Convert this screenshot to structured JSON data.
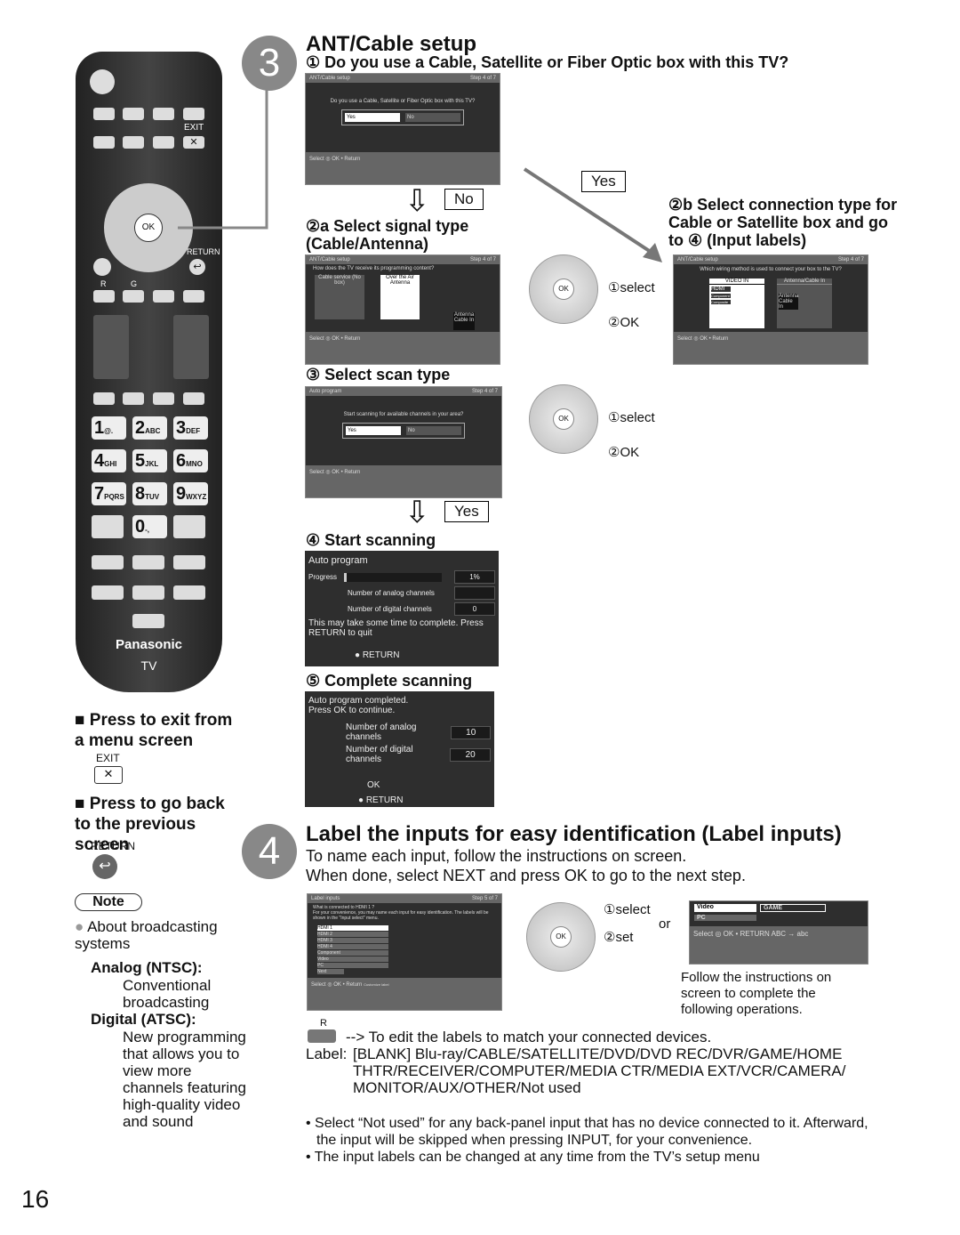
{
  "page_number": "16",
  "remote": {
    "exit": "EXIT",
    "ok": "OK",
    "return": "RETURN",
    "r": "R",
    "g": "G",
    "brand": "Panasonic",
    "tv": "TV",
    "keys": [
      {
        "n": "1",
        "s": "@."
      },
      {
        "n": "2",
        "s": "ABC"
      },
      {
        "n": "3",
        "s": "DEF"
      },
      {
        "n": "4",
        "s": "GHI"
      },
      {
        "n": "5",
        "s": "JKL"
      },
      {
        "n": "6",
        "s": "MNO"
      },
      {
        "n": "7",
        "s": "PQRS"
      },
      {
        "n": "8",
        "s": "TUV"
      },
      {
        "n": "9",
        "s": "WXYZ"
      },
      {
        "n": "0",
        "s": "-,"
      }
    ]
  },
  "sidebar": {
    "exit_title": "Press to exit from a menu screen",
    "exit_label": "EXIT",
    "back_title": "Press to go back to the previous screen",
    "back_label": "RETURN",
    "note": "Note",
    "note_item": "About broadcasting systems",
    "analog_title": "Analog (NTSC):",
    "analog_text": "Conventional broadcasting",
    "digital_title": "Digital (ATSC):",
    "digital_text": "New programming that allows you to view more channels featuring high-quality video and sound"
  },
  "step3": {
    "num": "3",
    "title": "ANT/Cable setup",
    "q1": "① Do you use a Cable, Satellite or Fiber Optic box with this TV?",
    "screen1": {
      "title": "ANT/Cable setup",
      "step": "Step 4 of 7",
      "question": "Do you use a Cable, Satellite or Fiber Optic box with this TV?",
      "yes": "Yes",
      "no": "No",
      "select": "Select",
      "ok": "OK",
      "return": "Return"
    },
    "no_label": "No",
    "yes_label": "Yes",
    "s2a": "②a Select signal type (Cable/Antenna)",
    "screen2a": {
      "title": "ANT/Cable setup",
      "step": "Step 4 of 7",
      "question": "How does the TV receive its programming content?",
      "opt1": "Cable service (No box)",
      "opt2": "Over the Air Antenna",
      "jack": "Antenna Cable In",
      "select": "Select",
      "ok": "OK",
      "return": "Return"
    },
    "s2b": "②b Select connection type for Cable or Satellite box and go to ④ (Input labels)",
    "screen2b": {
      "title": "ANT/Cable setup",
      "step": "Step 4 of 7",
      "question": "Which wiring method is used to connect your box to the TV?",
      "video_in": "VIDEO IN",
      "ant_in": "Antenna/Cable In",
      "hdmi": "HDMI",
      "component": "Component",
      "composite": "Composite",
      "jack": "Antenna Cable In",
      "select": "Select",
      "ok": "OK",
      "return": "Return"
    },
    "pad1": {
      "select": "①select",
      "ok": "②OK"
    },
    "s3": "③ Select scan type",
    "screen3": {
      "title": "Auto program",
      "step": "Step 4 of 7",
      "question": "Start scanning for available channels in your area?",
      "yes": "Yes",
      "no": "No",
      "select": "Select",
      "ok": "OK",
      "return": "Return"
    },
    "pad2": {
      "select": "①select",
      "ok": "②OK"
    },
    "yes_label2": "Yes",
    "s4": "④ Start scanning",
    "screen4": {
      "title": "Auto program",
      "progress": "Progress",
      "progress_value": "1%",
      "progress_pct": 1,
      "analog": "Number of analog channels",
      "analog_value": "",
      "digital": "Number of digital channels",
      "digital_value": "0",
      "note": "This may take some time to complete. Press RETURN to quit",
      "return": "RETURN"
    },
    "s5": "⑤ Complete scanning",
    "screen5": {
      "line1": "Auto program completed.",
      "line2": "Press OK to continue.",
      "analog": "Number of analog channels",
      "analog_value": "10",
      "digital": "Number of digital channels",
      "digital_value": "20",
      "ok": "OK",
      "return": "RETURN"
    }
  },
  "step4": {
    "num": "4",
    "title": "Label the inputs for easy identification (Label inputs)",
    "line1": "To name each input, follow the instructions on screen.",
    "line2": "When done, select NEXT and press OK to go to the next step.",
    "screen": {
      "title": "Label inputs",
      "step": "Step 5 of 7",
      "q": "What is connected to HDMI 1 ?",
      "desc": "For your convenience, you may name each input for easy identification. The labels will be shown in the \"Input select\" menu.",
      "inputs": [
        "HDMI 1",
        "HDMI 2",
        "HDMI 3",
        "HDMI 4",
        "Component",
        "Video",
        "PC",
        "Next"
      ],
      "select": "Select",
      "ok": "OK",
      "return": "Return",
      "customize": "Customize label"
    },
    "pad": {
      "select": "①select",
      "set": "②set",
      "ok": "OK"
    },
    "or": "or",
    "mini": {
      "video": "Video",
      "game": "GAME",
      "pc": "PC",
      "select": "Select",
      "ok": "OK",
      "return": "RETURN",
      "abc": "ABC → abc"
    },
    "follow": "Follow the instructions on screen to complete the following operations.",
    "r_label": "R",
    "r_text": "--> To edit the labels to match your connected devices.",
    "label_title": "Label:",
    "label_list": "[BLANK] Blu-ray/CABLE/SATELLITE/DVD/DVD REC/DVR/GAME/HOME THTR/RECEIVER/COMPUTER/MEDIA CTR/MEDIA EXT/VCR/CAMERA/ MONITOR/AUX/OTHER/Not used",
    "bullet1": "• Select “Not used” for any back-panel input that has no device connected to it. Afterward, the input will be skipped when pressing INPUT, for your convenience.",
    "bullet2": "• The input labels can be changed at any time from the TV’s setup menu"
  }
}
